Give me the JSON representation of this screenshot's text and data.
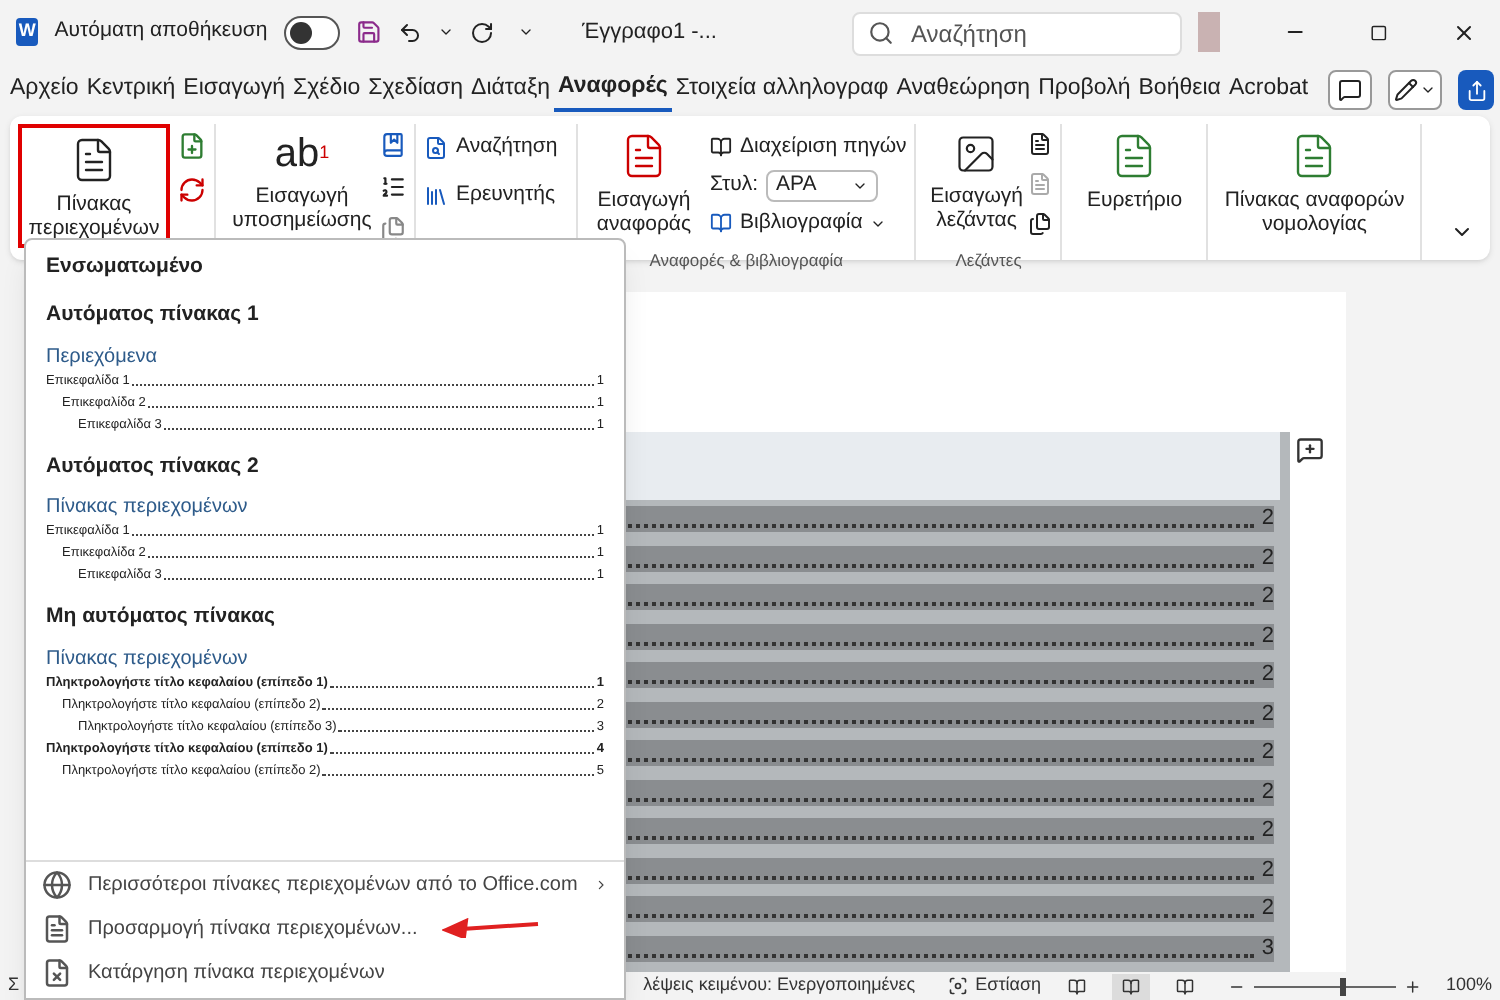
{
  "title_bar": {
    "app_letter": "W",
    "autosave_label": "Αυτόματη αποθήκευση",
    "autosave_on": false,
    "doc_title": "Έγγραφο1  -...",
    "search_placeholder": "Αναζήτηση"
  },
  "tabs": [
    {
      "label": "Αρχείο",
      "selected": false
    },
    {
      "label": "Κεντρική",
      "selected": false
    },
    {
      "label": "Εισαγωγή",
      "selected": false
    },
    {
      "label": "Σχέδιο",
      "selected": false
    },
    {
      "label": "Σχεδίαση",
      "selected": false
    },
    {
      "label": "Διάταξη",
      "selected": false
    },
    {
      "label": "Αναφορές",
      "selected": true
    },
    {
      "label": "Στοιχεία αλληλογραφ",
      "selected": false
    },
    {
      "label": "Αναθεώρηση",
      "selected": false
    },
    {
      "label": "Προβολή",
      "selected": false
    },
    {
      "label": "Βοήθεια",
      "selected": false
    },
    {
      "label": "Acrobat",
      "selected": false
    }
  ],
  "ribbon": {
    "toc_button": {
      "lines": [
        "Πίνακας",
        "περιεχομένων"
      ],
      "highlighted": true
    },
    "footnote_button": {
      "glyph": "ab",
      "superscript": "1",
      "lines": [
        "Εισαγωγή",
        "υποσημείωσης"
      ]
    },
    "research": [
      "Αναζήτηση",
      "Ερευνητής"
    ],
    "citation_button": {
      "lines": [
        "Εισαγωγή",
        "αναφοράς"
      ]
    },
    "manage_sources": "Διαχείριση πηγών",
    "style_label": "Στυλ:",
    "style_value": "APA",
    "bibliography": "Βιβλιογραφία",
    "citations_group_label": "Αναφορές & βιβλιογραφία",
    "caption_button": {
      "lines": [
        "Εισαγωγή",
        "λεζάντας"
      ]
    },
    "captions_group_label": "Λεζάντες",
    "index_button": {
      "lines": [
        "Ευρετήριο"
      ]
    },
    "authorities_button": {
      "lines": [
        "Πίνακας αναφορών",
        "νομολογίας"
      ]
    }
  },
  "document": {
    "toc_rows": [
      {
        "page": "2"
      },
      {
        "page": "2"
      },
      {
        "page": "2"
      },
      {
        "page": "2"
      },
      {
        "page": "2"
      },
      {
        "page": "2"
      },
      {
        "page": "2"
      },
      {
        "page": "2"
      },
      {
        "page": "2"
      },
      {
        "page": "2"
      },
      {
        "page": "2"
      },
      {
        "page": "3"
      }
    ]
  },
  "dropdown": {
    "section": "Ενσωματωμένο",
    "templates": [
      {
        "kind": "auto",
        "title": "Αυτόματος πίνακας 1",
        "heading": "Περιεχόμενα",
        "entries": [
          {
            "text": "Επικεφαλίδα 1",
            "page": "1",
            "children": [
              {
                "text": "Επικεφαλίδα 2",
                "page": "1",
                "children": [
                  {
                    "text": "Επικεφαλίδα 3",
                    "page": "1"
                  }
                ]
              }
            ]
          }
        ]
      },
      {
        "kind": "auto",
        "title": "Αυτόματος πίνακας 2",
        "heading": "Πίνακας περιεχομένων",
        "entries": [
          {
            "text": "Επικεφαλίδα 1",
            "page": "1",
            "children": [
              {
                "text": "Επικεφαλίδα 2",
                "page": "1",
                "children": [
                  {
                    "text": "Επικεφαλίδα 3",
                    "page": "1"
                  }
                ]
              }
            ]
          }
        ]
      },
      {
        "kind": "manual",
        "title": "Μη αυτόματος πίνακας",
        "heading": "Πίνακας περιεχομένων",
        "entries": [
          {
            "text": "Πληκτρολογήστε τίτλο κεφαλαίου (επίπεδο 1)",
            "page": "1",
            "children": [
              {
                "text": "Πληκτρολογήστε τίτλο κεφαλαίου (επίπεδο 2)",
                "page": "2",
                "children": [
                  {
                    "text": "Πληκτρολογήστε τίτλο κεφαλαίου (επίπεδο 3)",
                    "page": "3"
                  }
                ]
              }
            ]
          },
          {
            "text": "Πληκτρολογήστε τίτλο κεφαλαίου (επίπεδο 1)",
            "page": "4",
            "children": [
              {
                "text": "Πληκτρολογήστε τίτλο κεφαλαίου (επίπεδο 2)",
                "page": "5"
              }
            ]
          }
        ]
      }
    ],
    "actions": [
      {
        "kind": "globe",
        "label": "Περισσότεροι πίνακες περιεχομένων από το Office.com",
        "has_submenu": true,
        "pointed_at": false
      },
      {
        "kind": "document",
        "label": "Προσαρμογή πίνακα περιεχομένων...",
        "has_submenu": false,
        "pointed_at": true
      },
      {
        "kind": "remove",
        "label": "Κατάργηση πίνακα περιεχομένων",
        "has_submenu": false,
        "pointed_at": false
      }
    ]
  },
  "status_bar": {
    "left": "Σ",
    "proofing": "λέψεις κειμένου: Ενεργοποιημένες",
    "focus": "Εστίαση",
    "views": [
      {
        "selected": false
      },
      {
        "selected": true
      },
      {
        "selected": false
      }
    ],
    "zoom": {
      "level": 0.6,
      "reading": "100%"
    }
  }
}
